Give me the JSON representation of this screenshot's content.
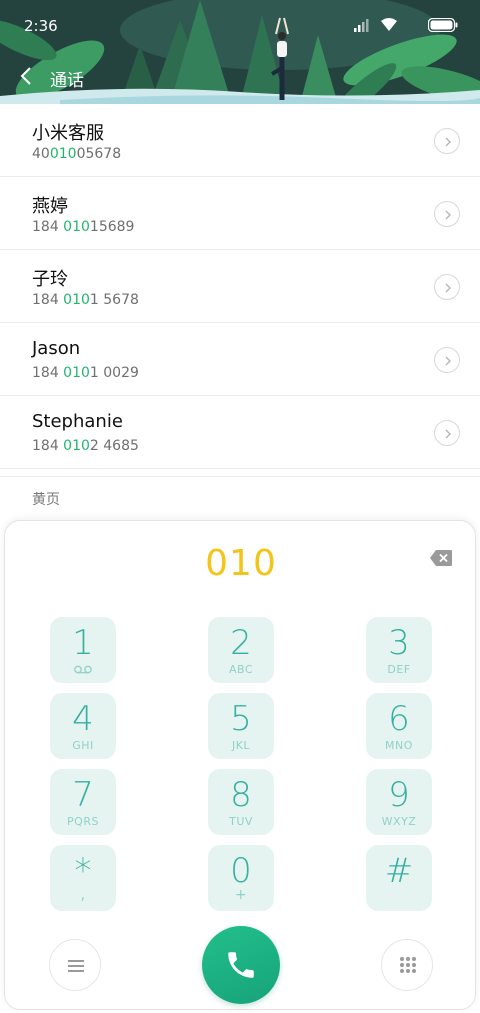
{
  "status_bar": {
    "time": "2:36"
  },
  "header": {
    "title": "通话"
  },
  "contacts": [
    {
      "name": "小米客服",
      "number_prefix": "40",
      "number_match": "010",
      "number_suffix": "05678"
    },
    {
      "name": "燕婷",
      "number_prefix": "184 ",
      "number_match": "010",
      "number_suffix": "15689"
    },
    {
      "name": "子玲",
      "number_prefix": "184 ",
      "number_match": "010",
      "number_suffix": "1 5678"
    },
    {
      "name": "Jason",
      "number_prefix": "184 ",
      "number_match": "010",
      "number_suffix": "1 0029"
    },
    {
      "name": "Stephanie",
      "number_prefix": "184 ",
      "number_match": "010",
      "number_suffix": "2 4685"
    }
  ],
  "yellow_pages": {
    "label": "黄页"
  },
  "dialpad": {
    "input": "010",
    "keys": [
      {
        "digit": "1",
        "letters": ""
      },
      {
        "digit": "2",
        "letters": "ABC"
      },
      {
        "digit": "3",
        "letters": "DEF"
      },
      {
        "digit": "4",
        "letters": "GHI"
      },
      {
        "digit": "5",
        "letters": "JKL"
      },
      {
        "digit": "6",
        "letters": "MNO"
      },
      {
        "digit": "7",
        "letters": "PQRS"
      },
      {
        "digit": "8",
        "letters": "TUV"
      },
      {
        "digit": "9",
        "letters": "WXYZ"
      },
      {
        "digit": "*",
        "letters": ","
      },
      {
        "digit": "0",
        "letters": "+"
      },
      {
        "digit": "#",
        "letters": ""
      }
    ]
  },
  "colors": {
    "match_highlight": "#22b56f",
    "dial_input": "#f3c51a",
    "key_background": "#e6f4f1",
    "key_digit": "#35b0a1",
    "call_button": "#1fb482"
  },
  "icons": {
    "back": "back-arrow-icon",
    "detail": "chevron-right-icon",
    "backspace": "backspace-icon",
    "menu": "menu-icon",
    "call": "phone-icon",
    "keypad_toggle": "keypad-icon",
    "voicemail": "voicemail-icon"
  }
}
